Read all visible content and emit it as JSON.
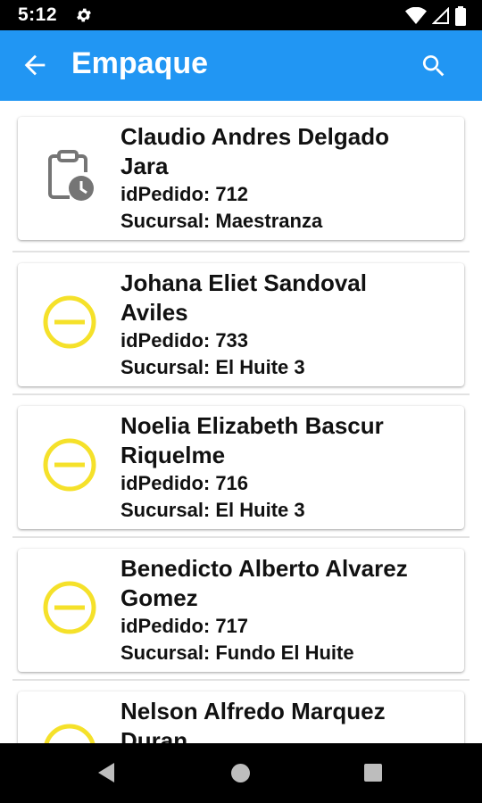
{
  "status_bar": {
    "time": "5:12"
  },
  "app_bar": {
    "title": "Empaque"
  },
  "orders": [
    {
      "name_line1": "Claudio Andres Delgado",
      "name_line2": "Jara",
      "id_text": "idPedido: 712",
      "branch_text": "Sucursal: Maestranza",
      "status_icon": "clipboard-clock-icon"
    },
    {
      "name_line1": "Johana Eliet Sandoval",
      "name_line2": "Aviles",
      "id_text": "idPedido: 733",
      "branch_text": "Sucursal: El Huite 3",
      "status_icon": "minus-circle-icon"
    },
    {
      "name_line1": "Noelia Elizabeth Bascur",
      "name_line2": "Riquelme",
      "id_text": "idPedido: 716",
      "branch_text": "Sucursal: El Huite 3",
      "status_icon": "minus-circle-icon"
    },
    {
      "name_line1": "Benedicto Alberto Alvarez",
      "name_line2": "Gomez",
      "id_text": "idPedido: 717",
      "branch_text": "Sucursal: Fundo El Huite",
      "status_icon": "minus-circle-icon"
    },
    {
      "name_line1": "Nelson Alfredo Marquez",
      "name_line2": "Duran",
      "id_text": "",
      "branch_text": "",
      "status_icon": "minus-circle-icon"
    }
  ],
  "colors": {
    "app_bar": "#2196f3",
    "pending_icon": "#f5e12a",
    "clipboard_icon": "#757575"
  }
}
